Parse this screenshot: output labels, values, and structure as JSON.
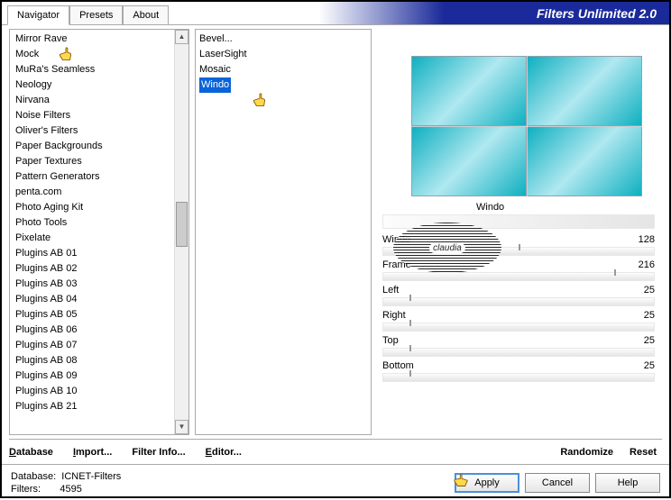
{
  "app_title": "Filters Unlimited 2.0",
  "tabs": {
    "navigator": "Navigator",
    "presets": "Presets",
    "about": "About"
  },
  "categories": [
    "Mirror Rave",
    "Mock",
    "MuRa's Seamless",
    "Neology",
    "Nirvana",
    "Noise Filters",
    "Oliver's Filters",
    "Paper Backgrounds",
    "Paper Textures",
    "Pattern Generators",
    "penta.com",
    "Photo Aging Kit",
    "Photo Tools",
    "Pixelate",
    "Plugins AB 01",
    "Plugins AB 02",
    "Plugins AB 03",
    "Plugins AB 04",
    "Plugins AB 05",
    "Plugins AB 06",
    "Plugins AB 07",
    "Plugins AB 08",
    "Plugins AB 09",
    "Plugins AB 10",
    "Plugins AB 21"
  ],
  "filters": [
    "Bevel...",
    "LaserSight",
    "Mosaic",
    "Windo"
  ],
  "selected_filter": "Windo",
  "params": [
    {
      "name": "Windo",
      "value": 128,
      "pos": 50
    },
    {
      "name": "Frame",
      "value": 216,
      "pos": 85
    },
    {
      "name": "Left",
      "value": 25,
      "pos": 10
    },
    {
      "name": "Right",
      "value": 25,
      "pos": 10
    },
    {
      "name": "Top",
      "value": 25,
      "pos": 10
    },
    {
      "name": "Bottom",
      "value": 25,
      "pos": 10
    }
  ],
  "toolbar": {
    "database": "Database",
    "import": "Import...",
    "filterinfo": "Filter Info...",
    "editor": "Editor...",
    "randomize": "Randomize",
    "reset": "Reset"
  },
  "footer": {
    "db_label": "Database:",
    "db_val": "ICNET-Filters",
    "flt_label": "Filters:",
    "flt_val": "4595",
    "apply": "Apply",
    "cancel": "Cancel",
    "help": "Help"
  },
  "watermark": "claudia"
}
